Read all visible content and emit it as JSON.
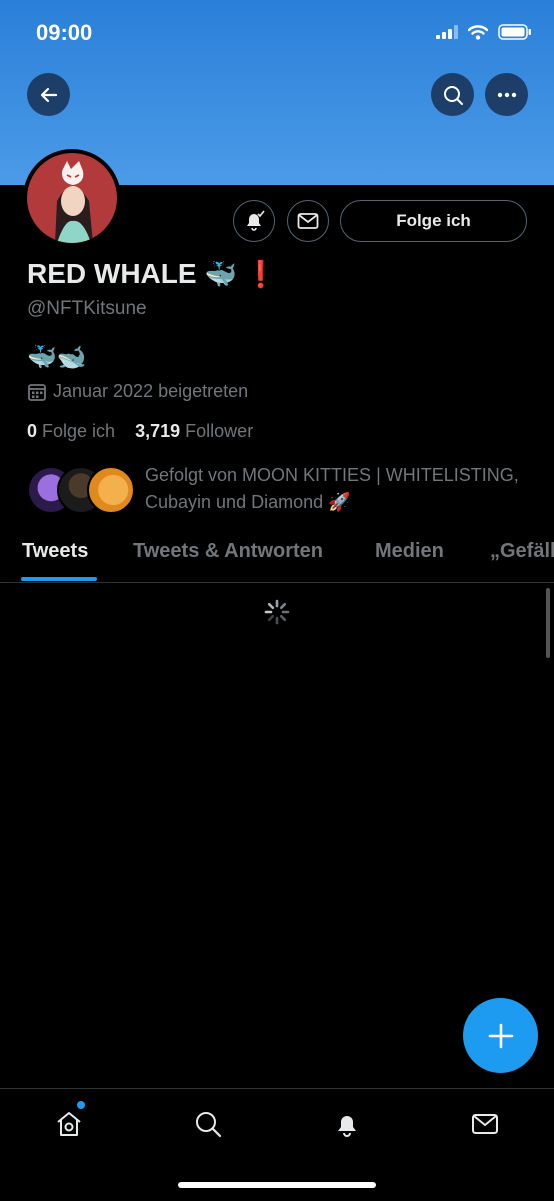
{
  "status_bar": {
    "time": "09:00"
  },
  "profile": {
    "name": "RED WHALE",
    "name_emoji": "🐳",
    "name_mark": "❗",
    "handle": "@NFTKitsune",
    "bio_emojis": "🐳🐋",
    "joined": "Januar 2022 beigetreten",
    "following_count": "0",
    "following_label": "Folge ich",
    "followers_count": "3,719",
    "followers_label": "Follower",
    "followed_by_text": "Gefolgt von MOON KITTIES | WHITELISTING, Cubayin und Diamond 🚀",
    "follow_button_label": "Folge ich"
  },
  "tabs": [
    {
      "label": "Tweets",
      "active": true
    },
    {
      "label": "Tweets & Antworten",
      "active": false
    },
    {
      "label": "Medien",
      "active": false
    },
    {
      "label": "„Gefällt mir“",
      "active": false
    }
  ],
  "icons": {
    "back": "arrow-left-icon",
    "search": "search-icon",
    "more": "more-icon",
    "notifications": "bell-check-icon",
    "message": "envelope-icon",
    "compose": "plus-icon",
    "calendar": "calendar-icon",
    "spinner": "loading-spinner-icon",
    "nav": [
      "home-icon",
      "search-icon",
      "bell-icon",
      "envelope-icon"
    ]
  },
  "colors": {
    "accent": "#1d9bf0",
    "banner": "#3d8fe3",
    "background": "#000000",
    "secondary_text": "#71767b"
  }
}
